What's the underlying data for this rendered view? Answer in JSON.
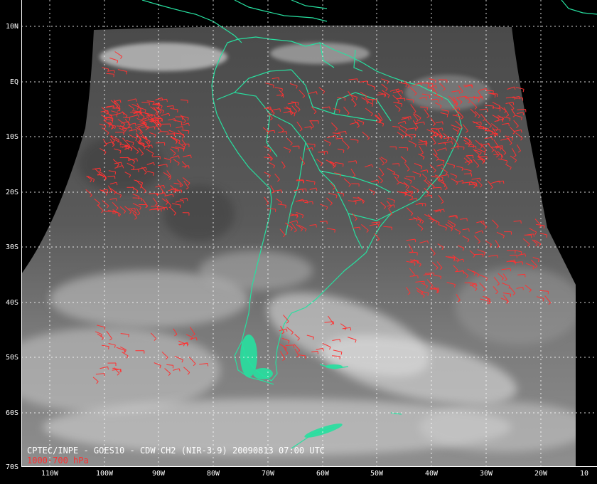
{
  "caption": "CPTEC/INPE - GOES10 - CDW CH2 (NIR-3.9) 20090813 07:00 UTC",
  "level_label": "1000-700 hPa",
  "lat_labels": [
    "10N",
    "EQ",
    "10S",
    "20S",
    "30S",
    "40S",
    "50S",
    "60S",
    "70S"
  ],
  "lon_labels": [
    "110W",
    "100W",
    "90W",
    "80W",
    "70W",
    "60W",
    "50W",
    "40W",
    "30W",
    "20W",
    "10"
  ],
  "colors": {
    "background": "#000000",
    "coastline": "#27e0a0",
    "wind_barbs": "#ff3232",
    "grid": "#ffffff",
    "caption_text": "#ffffff",
    "level_text": "#ff3030"
  }
}
